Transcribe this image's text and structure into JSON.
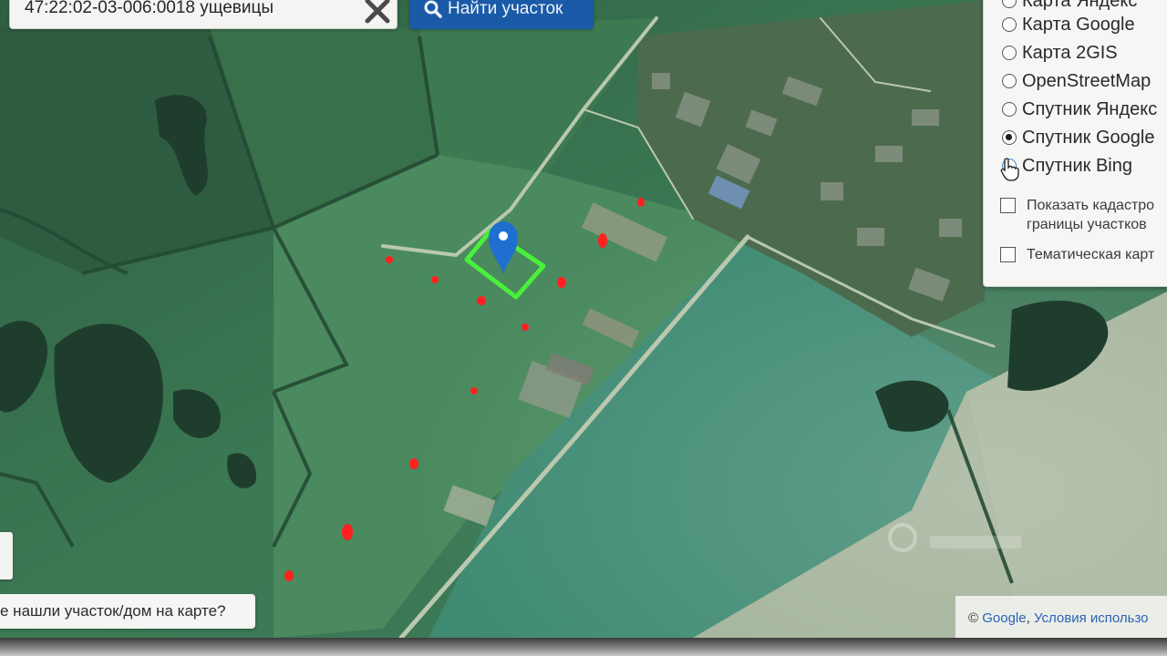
{
  "search": {
    "value": "47:22:02-03-006:0018 ущевицы",
    "find_label": "Найти участок"
  },
  "layers": {
    "options": [
      {
        "label": "Карта Яндекс",
        "checked": false
      },
      {
        "label": "Карта Google",
        "checked": false
      },
      {
        "label": "Карта 2GIS",
        "checked": false
      },
      {
        "label": "OpenStreetMap",
        "checked": false
      },
      {
        "label": "Спутник Яндекс",
        "checked": false
      },
      {
        "label": "Спутник Google",
        "checked": true
      },
      {
        "label": "Спутник Bing",
        "checked": false
      }
    ],
    "cadastral_label_1": "Показать кадастро",
    "cadastral_label_2": "границы участков",
    "thematic_label": "Тематическая карт"
  },
  "help_label": "е нашли участок/дом на карте?",
  "attribution": {
    "symbol": "©",
    "google": "Google",
    "terms": "Условия использо"
  },
  "colors": {
    "parcel_outline": "#49f03b",
    "marker": "#1f6fd1",
    "red_dots": "#ff2020",
    "button": "#1a5aa6"
  },
  "icons": [
    "search-icon",
    "close-icon",
    "location-pin-icon",
    "hand-cursor-icon"
  ]
}
